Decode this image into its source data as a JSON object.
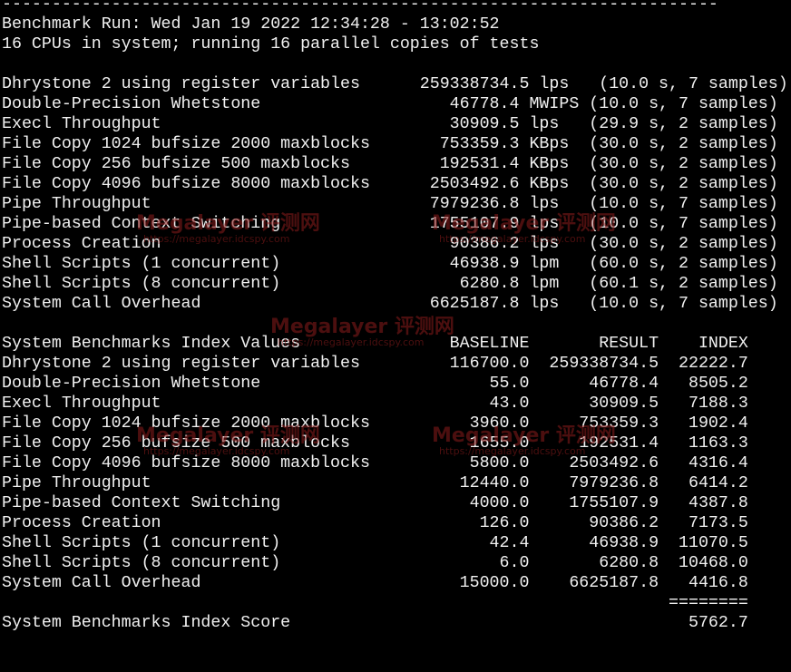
{
  "terminal": {
    "lines": [
      "------------------------------------------------------------------------",
      "Benchmark Run: Wed Jan 19 2022 12:34:28 - 13:02:52",
      "16 CPUs in system; running 16 parallel copies of tests",
      "",
      "Dhrystone 2 using register variables      259338734.5 lps   (10.0 s, 7 samples)",
      "Double-Precision Whetstone                   46778.4 MWIPS (10.0 s, 7 samples)",
      "Execl Throughput                             30909.5 lps   (29.9 s, 2 samples)",
      "File Copy 1024 bufsize 2000 maxblocks       753359.3 KBps  (30.0 s, 2 samples)",
      "File Copy 256 bufsize 500 maxblocks         192531.4 KBps  (30.0 s, 2 samples)",
      "File Copy 4096 bufsize 8000 maxblocks      2503492.6 KBps  (30.0 s, 2 samples)",
      "Pipe Throughput                            7979236.8 lps   (10.0 s, 7 samples)",
      "Pipe-based Context Switching               1755107.9 lps   (10.0 s, 7 samples)",
      "Process Creation                             90386.2 lps   (30.0 s, 2 samples)",
      "Shell Scripts (1 concurrent)                 46938.9 lpm   (60.0 s, 2 samples)",
      "Shell Scripts (8 concurrent)                  6280.8 lpm   (60.1 s, 2 samples)",
      "System Call Overhead                       6625187.8 lps   (10.0 s, 7 samples)",
      "",
      "System Benchmarks Index Values               BASELINE       RESULT    INDEX",
      "Dhrystone 2 using register variables         116700.0  259338734.5  22222.7",
      "Double-Precision Whetstone                       55.0      46778.4   8505.2",
      "Execl Throughput                                 43.0      30909.5   7188.3",
      "File Copy 1024 bufsize 2000 maxblocks          3960.0     753359.3   1902.4",
      "File Copy 256 bufsize 500 maxblocks            1655.0     192531.4   1163.3",
      "File Copy 4096 bufsize 8000 maxblocks          5800.0    2503492.6   4316.4",
      "Pipe Throughput                               12440.0    7979236.8   6414.2",
      "Pipe-based Context Switching                   4000.0    1755107.9   4387.8",
      "Process Creation                                126.0      90386.2   7173.5",
      "Shell Scripts (1 concurrent)                     42.4      46938.9  11070.5",
      "Shell Scripts (8 concurrent)                      6.0       6280.8  10468.0",
      "System Call Overhead                          15000.0    6625187.8   4416.8",
      "                                                                   ========",
      "System Benchmarks Index Score                                        5762.7"
    ]
  },
  "watermark": {
    "brand": "Megalayer 评测网",
    "url": "https://megalayer.idcspy.com"
  }
}
